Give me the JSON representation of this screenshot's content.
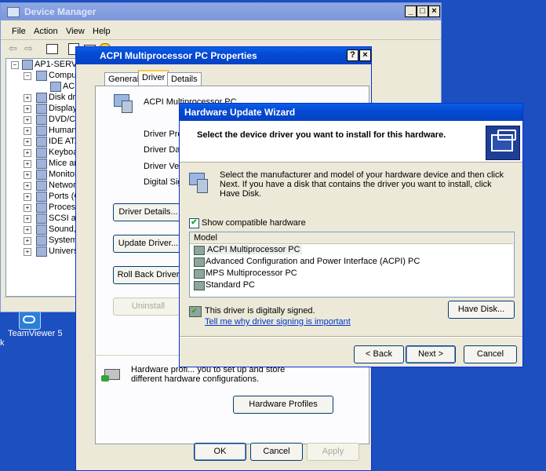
{
  "desktop": {
    "teamviewer_label": "TeamViewer 5",
    "left_edge_letter": "k"
  },
  "device_manager": {
    "title": "Device Manager",
    "menu": [
      "File",
      "Action",
      "View",
      "Help"
    ],
    "tree": [
      {
        "label": "AP1-SERVER",
        "level": 0
      },
      {
        "label": "Computer",
        "level": 1,
        "expanded": true
      },
      {
        "label": "ACPI Multip",
        "level": 2
      },
      {
        "label": "Disk drives",
        "level": 1
      },
      {
        "label": "Display adapte",
        "level": 1
      },
      {
        "label": "DVD/CD-ROM d",
        "level": 1
      },
      {
        "label": "Human Interfa",
        "level": 1
      },
      {
        "label": "IDE ATA/ATAP",
        "level": 1
      },
      {
        "label": "Keyboards",
        "level": 1
      },
      {
        "label": "Mice and other",
        "level": 1
      },
      {
        "label": "Monitors",
        "level": 1
      },
      {
        "label": "Network adapt",
        "level": 1
      },
      {
        "label": "Ports (COM & L",
        "level": 1
      },
      {
        "label": "Processors",
        "level": 1
      },
      {
        "label": "SCSI and RAID",
        "level": 1
      },
      {
        "label": "Sound, video a",
        "level": 1
      },
      {
        "label": "System devices",
        "level": 1
      },
      {
        "label": "Universal Seria",
        "level": 1
      }
    ]
  },
  "properties": {
    "title": "ACPI Multiprocessor PC Properties",
    "help_btn": "?",
    "close_btn": "×",
    "tabs": [
      "General",
      "Driver",
      "Details"
    ],
    "device_name": "ACPI Multiprocessor PC",
    "fields": [
      "Driver Prov",
      "Driver Date",
      "Driver Vers",
      "Digital Sign"
    ],
    "buttons": {
      "details": "Driver Details...",
      "update": "Update Driver...",
      "rollback": "Roll Back Driver",
      "uninstall": "Uninstall"
    },
    "hw_profile_text": "Hardware profi... you to set up and store\ndifferent hardware configurations.",
    "hw_profiles_button": "Hardware Profiles",
    "ok": "OK",
    "cancel": "Cancel",
    "apply": "Apply"
  },
  "wizard": {
    "title": "Hardware Update Wizard",
    "heading": "Select the device driver you want to install for this hardware.",
    "instructions": "Select the manufacturer and model of your hardware device and then click Next. If you have a disk that contains the driver you want to install, click Have Disk.",
    "show_compatible": "Show compatible hardware",
    "model_header": "Model",
    "models": [
      "ACPI Multiprocessor PC",
      "Advanced Configuration and Power Interface (ACPI) PC",
      "MPS Multiprocessor PC",
      "Standard PC"
    ],
    "signed_text": "This driver is digitally signed.",
    "signing_link": "Tell me why driver signing is important",
    "have_disk": "Have Disk...",
    "back": "< Back",
    "next": "Next >",
    "cancel": "Cancel"
  }
}
